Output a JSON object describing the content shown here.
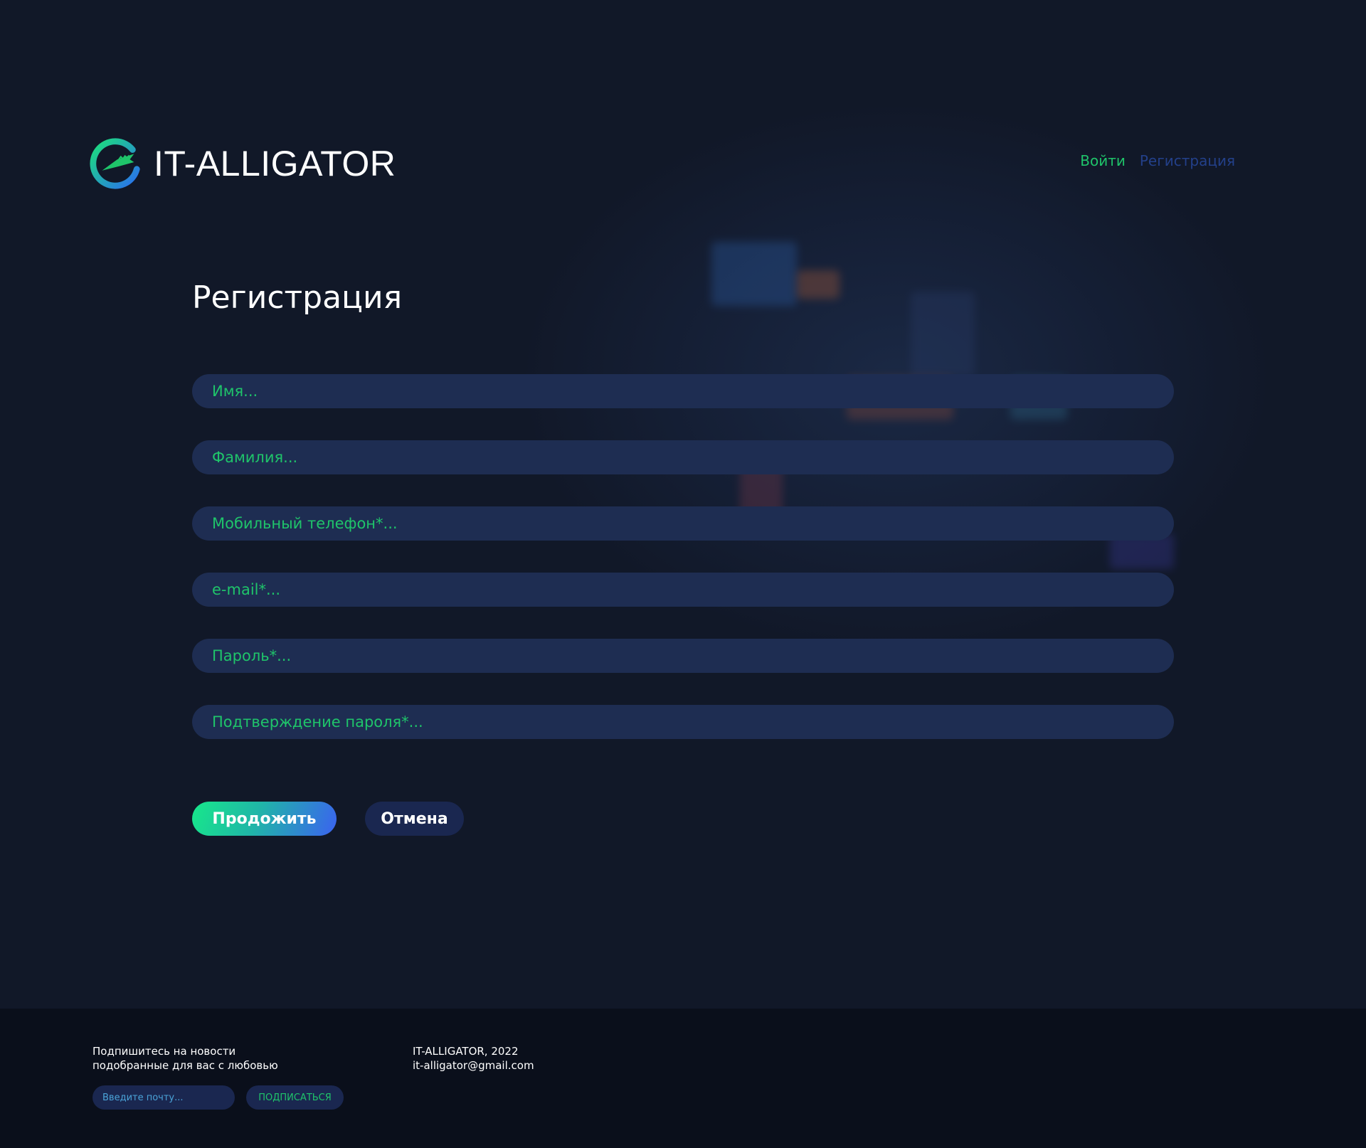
{
  "header": {
    "logo_text": "IT-ALLIGATOR",
    "nav": {
      "login": "Войти",
      "register": "Регистрация"
    }
  },
  "page": {
    "title": "Регистрация"
  },
  "form": {
    "fields": {
      "first_name": "Имя...",
      "last_name": "Фамилия...",
      "phone": "Мобильный телефон*...",
      "email": "e-mail*...",
      "password": "Пароль*...",
      "password_confirm": "Подтверждение пароля*..."
    },
    "continue_label": "Продожить",
    "cancel_label": "Отмена"
  },
  "footer": {
    "subscribe_line1": "Подпишитесь на новости",
    "subscribe_line2": "подобранные для вас с любовью",
    "email_placeholder": "Введите почту...",
    "subscribe_button": "ПОДПИСАТЬСЯ",
    "copyright": "IT-ALLIGATOR, 2022",
    "contact_email": "it-alligator@gmail.com"
  },
  "colors": {
    "background": "#111828",
    "accent_green": "#1fc46a",
    "field_bg": "#1e2d52",
    "footer_bg": "#0a0f1b",
    "nav_register": "#23408a"
  },
  "icons": {
    "logo": "alligator-logo-icon"
  }
}
